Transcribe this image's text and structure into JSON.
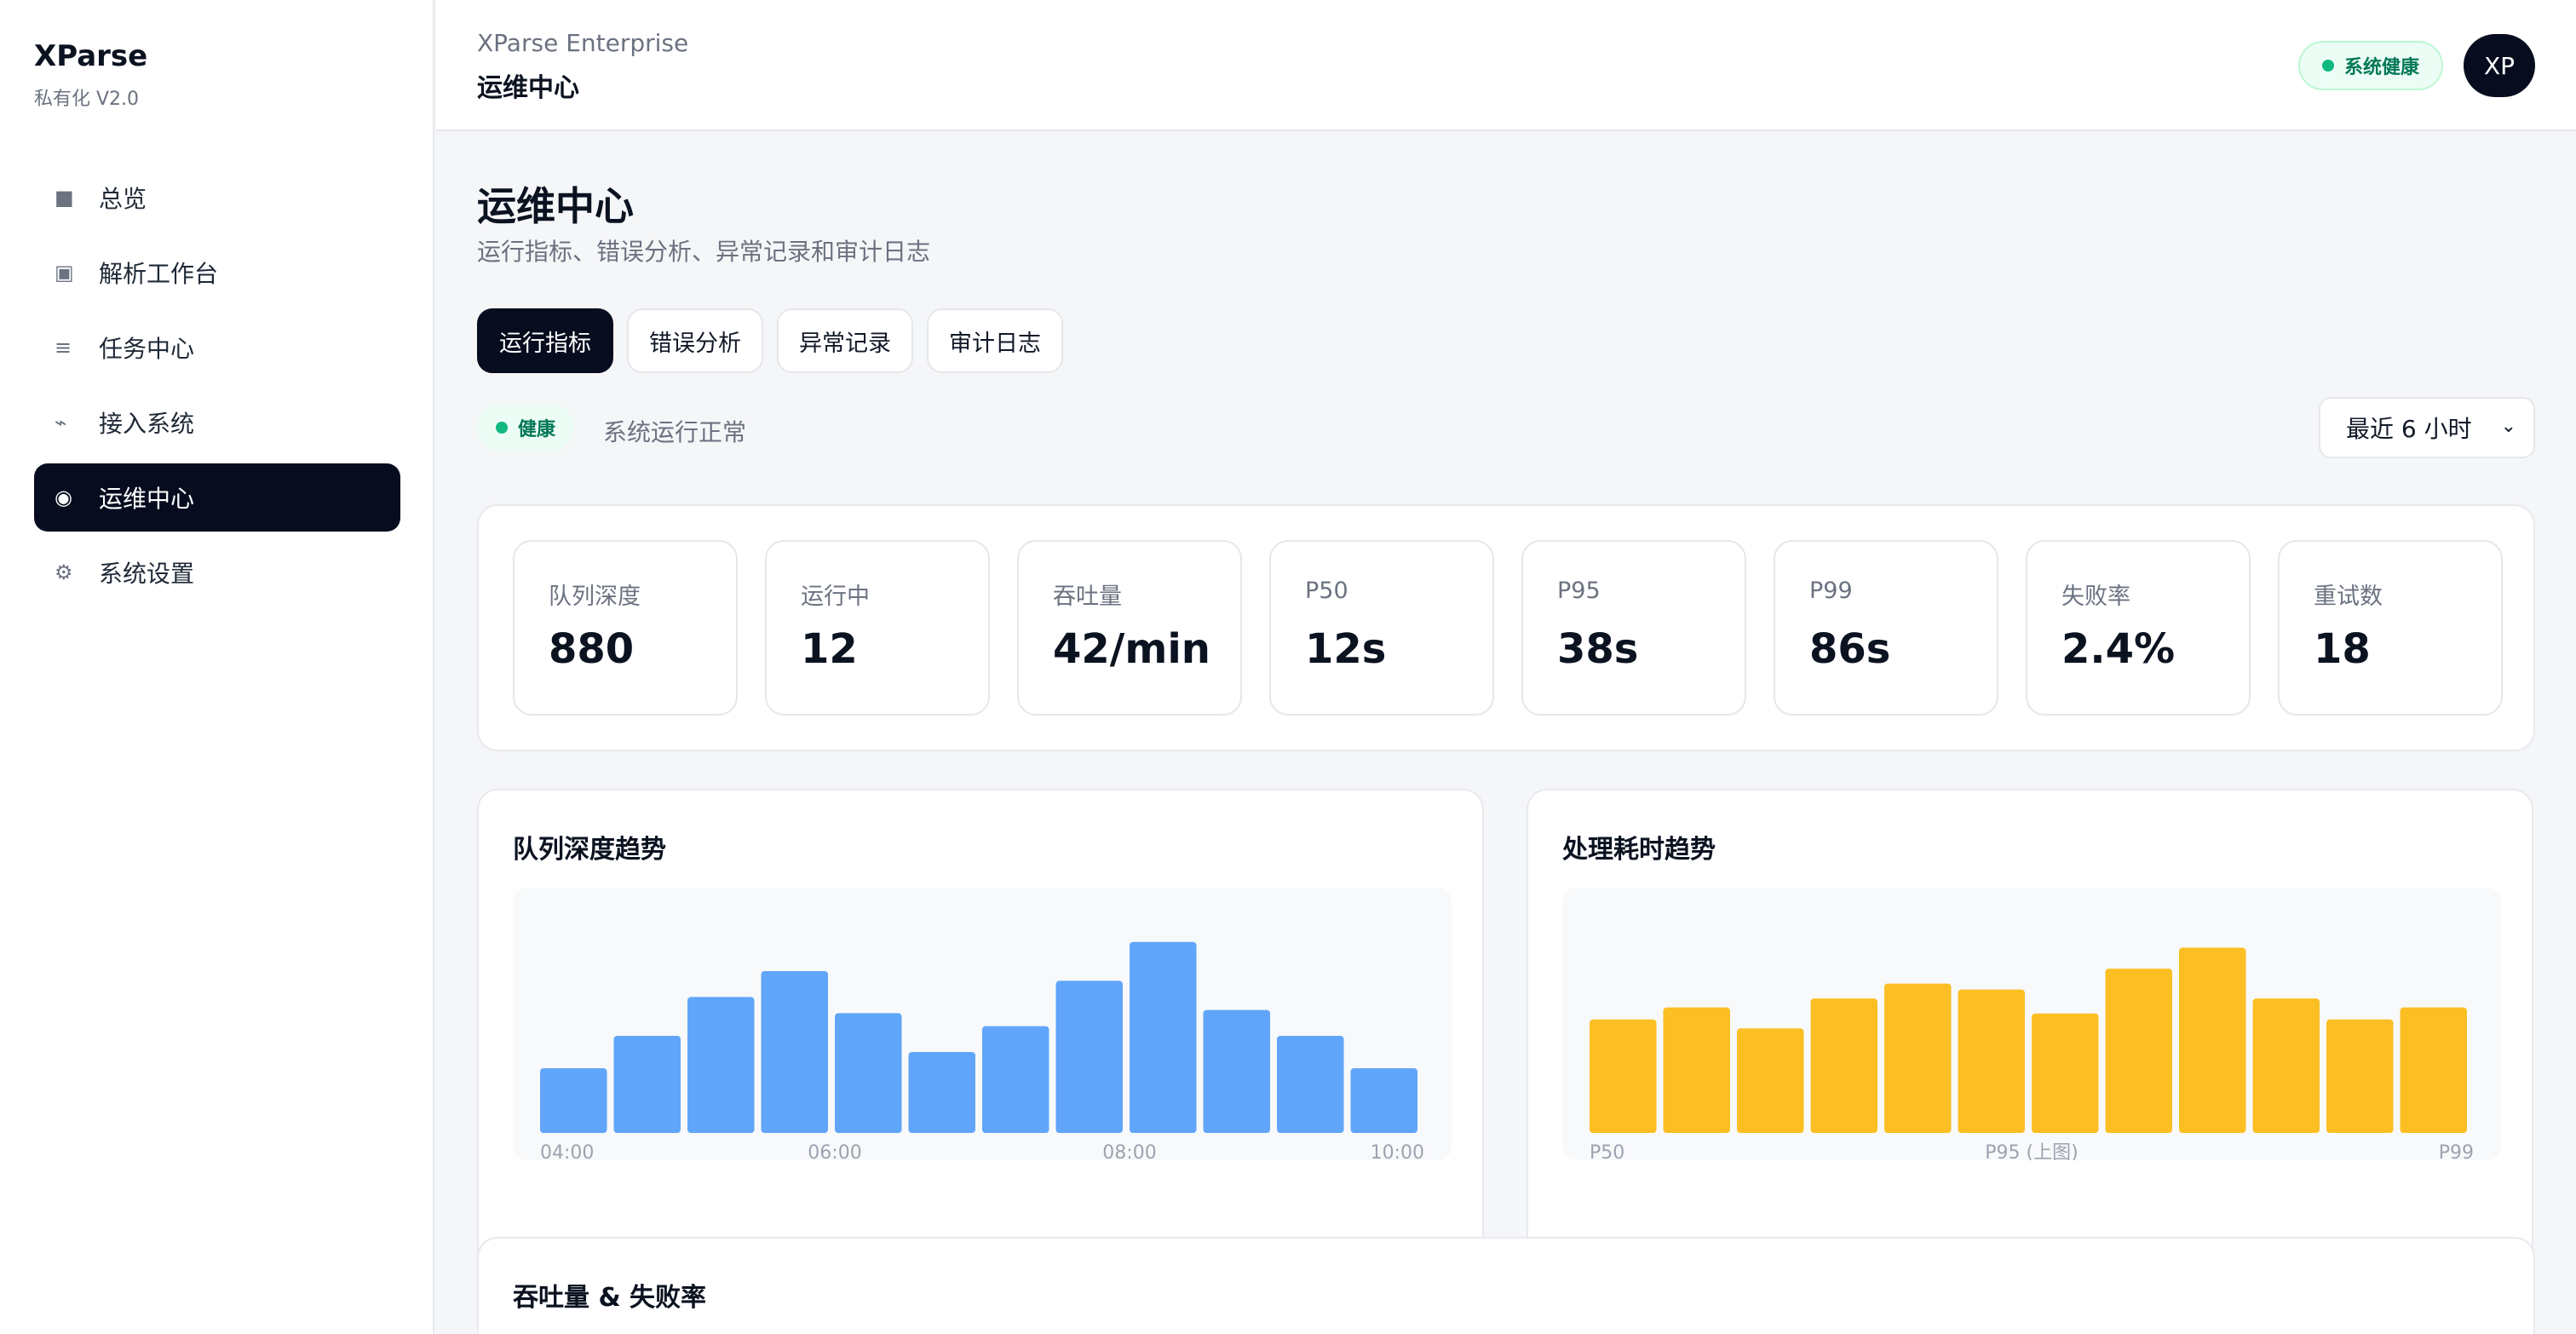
{
  "sidebar": {
    "brand_title": "XParse",
    "brand_sub": "私有化 V2.0",
    "items": [
      {
        "label": "总览",
        "icon": "■"
      },
      {
        "label": "解析工作台",
        "icon": "▣"
      },
      {
        "label": "任务中心",
        "icon": "≡"
      },
      {
        "label": "接入系统",
        "icon": "⌁"
      },
      {
        "label": "运维中心",
        "icon": "◉"
      },
      {
        "label": "系统设置",
        "icon": "⚙"
      }
    ]
  },
  "header": {
    "subtitle": "XParse Enterprise",
    "title": "运维中心",
    "health_label": "系统健康",
    "avatar": "XP"
  },
  "page": {
    "title": "运维中心",
    "description": "运行指标、错误分析、异常记录和审计日志",
    "tabs": [
      "运行指标",
      "错误分析",
      "异常记录",
      "审计日志"
    ]
  },
  "status": {
    "badge": "健康",
    "text": "系统运行正常",
    "range": "最近 6 小时",
    "chevron": "⌄"
  },
  "metrics": [
    {
      "label": "队列深度",
      "value": "880"
    },
    {
      "label": "运行中",
      "value": "12"
    },
    {
      "label": "吞吐量",
      "value": "42/min"
    },
    {
      "label": "P50",
      "value": "12s"
    },
    {
      "label": "P95",
      "value": "38s"
    },
    {
      "label": "P99",
      "value": "86s"
    },
    {
      "label": "失败率",
      "value": "2.4%"
    },
    {
      "label": "重试数",
      "value": "18"
    }
  ],
  "chart_data": [
    {
      "type": "bar",
      "title": "队列深度趋势",
      "values": [
        20,
        30,
        42,
        50,
        37,
        25,
        33,
        47,
        59,
        38,
        30,
        20
      ],
      "x_tick_labels": [
        "04:00",
        "06:00",
        "08:00",
        "10:00"
      ],
      "color": "#60a5fa",
      "ylim": [
        0,
        60
      ]
    },
    {
      "type": "bar",
      "title": "处理耗时趋势",
      "values": [
        38,
        42,
        35,
        45,
        50,
        48,
        40,
        55,
        62,
        45,
        38,
        42
      ],
      "x_tick_labels": [
        "P50",
        "P95 (上图)",
        "P99"
      ],
      "color": "#fbbf24",
      "ylim": [
        0,
        65
      ]
    }
  ],
  "bottom": {
    "title": "吞吐量 & 失败率"
  },
  "colors": {
    "accent_dark": "#070d1e",
    "health_green": "#10b981",
    "bar_blue": "#60a5fa",
    "bar_yellow": "#fbbf24"
  }
}
